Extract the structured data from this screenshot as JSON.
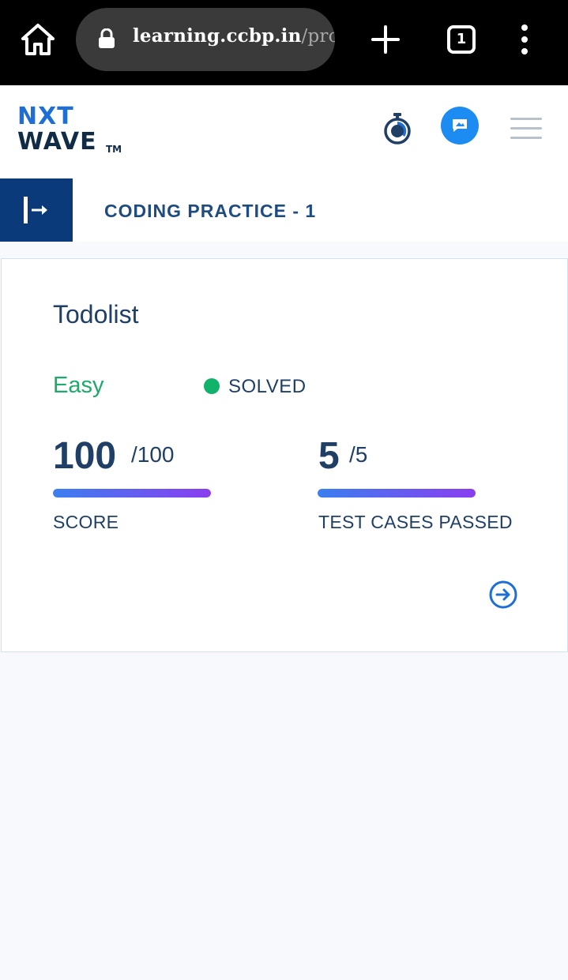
{
  "browser": {
    "url_domain": "learning.ccbp.in",
    "url_path": "/proj",
    "tab_count": "1"
  },
  "header": {
    "logo_top": "NXT",
    "logo_bottom": "WAVE",
    "logo_tm": "TM"
  },
  "sub_header": {
    "title": "CODING PRACTICE - 1"
  },
  "question": {
    "title": "Todolist",
    "difficulty": "Easy",
    "status": "SOLVED",
    "score": {
      "value": "100",
      "total": "/100",
      "label": "SCORE",
      "fraction": 1.0
    },
    "test_cases": {
      "value": "5",
      "total": "/5",
      "label": "TEST CASES PASSED",
      "fraction": 1.0
    }
  },
  "colors": {
    "accent": "#0b3a7a",
    "difficulty_easy": "#1eaa6a",
    "solved_dot": "#11b36a",
    "progress_start": "#3b7ff0",
    "progress_end": "#8a3df0"
  },
  "icons": {
    "home": "home-icon",
    "lock": "lock-icon",
    "new_tab": "plus-icon",
    "tabs": "tabs-icon",
    "menu_more": "kebab-icon",
    "timer": "stopwatch-icon",
    "chat": "chat-icon",
    "hamburger": "hamburger-icon",
    "collapse": "expand-sidebar-icon",
    "open": "arrow-right-circle-icon"
  }
}
